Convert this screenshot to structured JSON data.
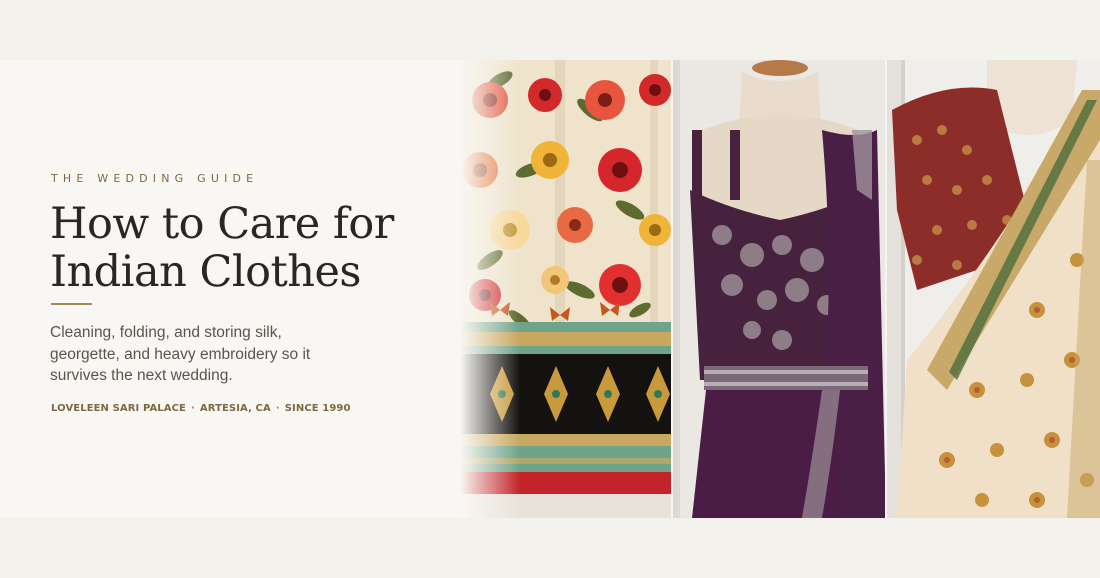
{
  "hero": {
    "eyebrow": "THE WEDDING GUIDE",
    "title_line1": "How to Care for",
    "title_line2": "Indian Clothes",
    "description": "Cleaning, folding, and storing silk, georgette, and heavy embroidery so it survives the next wedding.",
    "meta": {
      "store": "LOVELEEN SARI PALACE",
      "location": "ARTESIA, CA",
      "since": "SINCE 1990",
      "separator": "·"
    }
  },
  "images": [
    {
      "subject": "floral-lehenga-skirt-photo"
    },
    {
      "subject": "purple-saree-gown-on-mannequin-photo"
    },
    {
      "subject": "cream-saree-with-red-blouse-photo"
    }
  ],
  "colors": {
    "background": "#f3f1ec",
    "panel": "#f9f7f3",
    "accent": "#7a6a42",
    "title": "#2b2622",
    "body_text": "#5a544d"
  }
}
